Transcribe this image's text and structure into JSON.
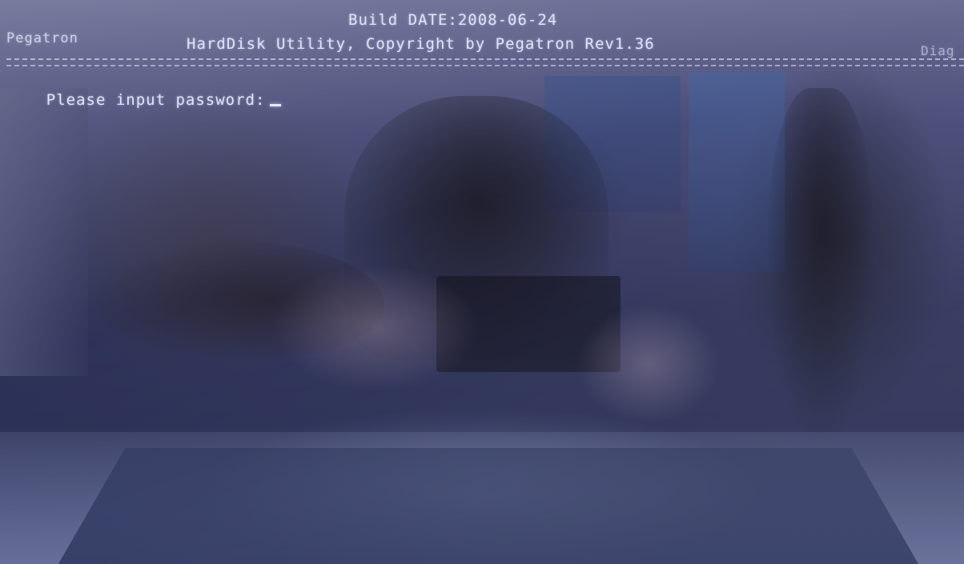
{
  "bios": {
    "build_date": "Build DATE:2008-06-24",
    "brand_left": "Pegatron",
    "utility_title": "HardDisk Utility, Copyright by Pegatron Rev1.36",
    "brand_right": "Diag",
    "separator": "================================================================================================",
    "prompt": "Please input password:"
  },
  "colors": {
    "screen_background": "#3a3e6a",
    "text": "#dfe3f6"
  }
}
